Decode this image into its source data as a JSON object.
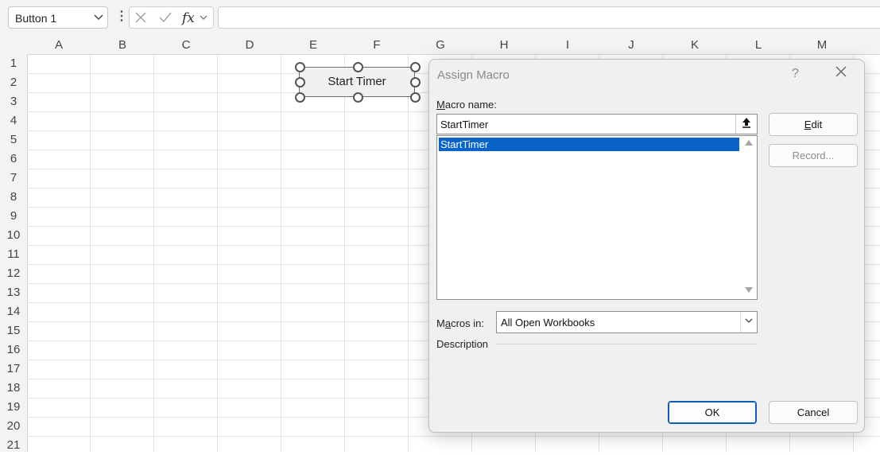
{
  "formula_bar": {
    "name_box": "Button 1",
    "cancel_icon": "x-icon",
    "enter_icon": "check-icon",
    "fx_label": "fx",
    "formula_value": ""
  },
  "grid": {
    "columns": [
      "A",
      "B",
      "C",
      "D",
      "E",
      "F",
      "G",
      "H",
      "I",
      "J",
      "K",
      "L",
      "M"
    ],
    "rows": [
      "1",
      "2",
      "3",
      "4",
      "5",
      "6",
      "7",
      "8",
      "9",
      "10",
      "11",
      "12",
      "13",
      "14",
      "15",
      "16",
      "17",
      "18",
      "19",
      "20",
      "21"
    ]
  },
  "form_button": {
    "label": "Start Timer"
  },
  "dialog": {
    "title": "Assign Macro",
    "help": "?",
    "macro_name_label_access": "M",
    "macro_name_label_rest": "acro name:",
    "macro_name_value": "StartTimer",
    "macro_list": [
      "StartTimer"
    ],
    "edit_access": "E",
    "edit_rest": "dit",
    "record_label": "Record...",
    "macros_in_label_a": "M",
    "macros_in_label_access": "a",
    "macros_in_label_rest": "cros in:",
    "macros_in_value": "All Open Workbooks",
    "description_label": "Description",
    "ok_label": "OK",
    "cancel_label": "Cancel"
  }
}
